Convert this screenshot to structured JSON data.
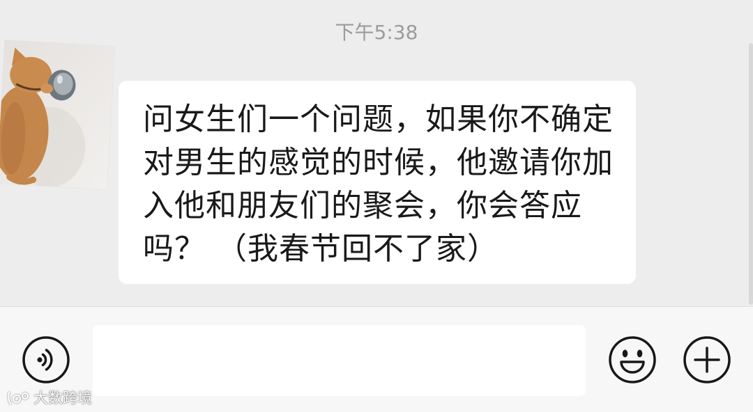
{
  "colors": {
    "chat_background": "#ededed",
    "bubble_background": "#ffffff",
    "message_text": "#191919",
    "timestamp_text": "#9b9b9b",
    "input_bar_background": "#f7f7f7",
    "icon_stroke": "#181818"
  },
  "chat": {
    "timestamp": "下午5:38",
    "incoming_message": {
      "avatar_icon": "cat-photo-avatar-icon",
      "lines": [
        "问女生们一个问题，如果你不确定",
        "对男生的感觉的时候，他邀请你加",
        "入他和朋友们的聚会，你会答应",
        "吗？ （我春节回不了家）"
      ]
    }
  },
  "input_bar": {
    "voice_button_icon": "voice-icon",
    "emoji_button_icon": "emoji-icon",
    "more_button_icon": "plus-icon"
  },
  "watermark": {
    "logo_icon": "watermark-logo-icon",
    "text": "大数跨境"
  }
}
